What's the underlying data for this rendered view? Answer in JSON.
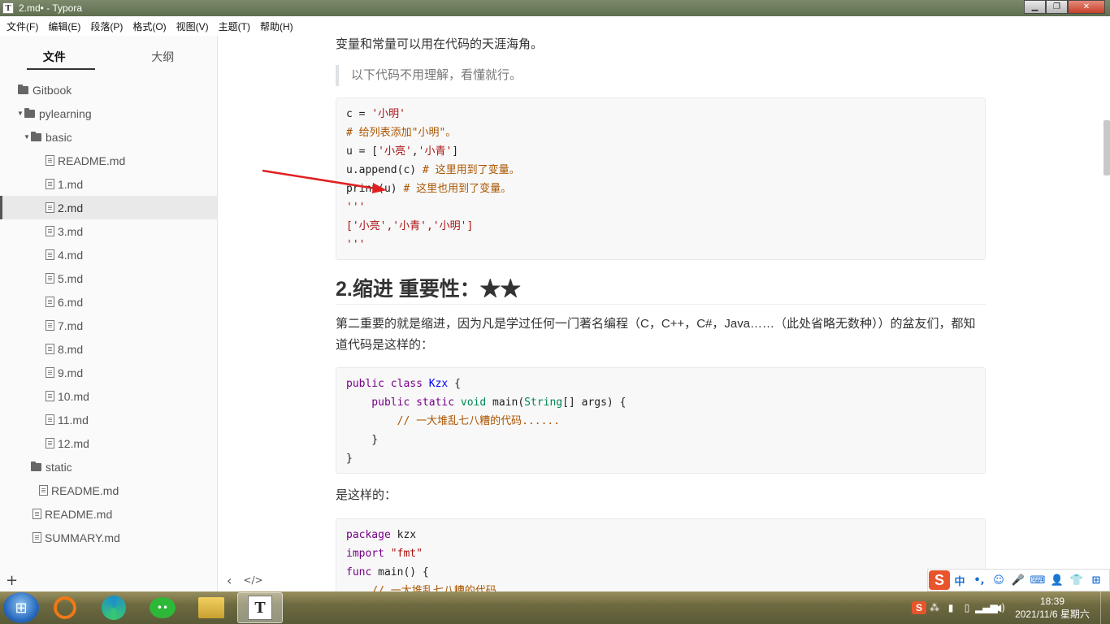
{
  "window": {
    "title": "2.md• - Typora"
  },
  "menu": [
    "文件(F)",
    "编辑(E)",
    "段落(P)",
    "格式(O)",
    "视图(V)",
    "主题(T)",
    "帮助(H)"
  ],
  "sidebar": {
    "tabs": [
      "文件",
      "大纲"
    ],
    "tree": [
      {
        "label": "Gitbook",
        "type": "folder",
        "level": 0,
        "expanded": false
      },
      {
        "label": "pylearning",
        "type": "folder",
        "level": 1,
        "expanded": true
      },
      {
        "label": "basic",
        "type": "folder",
        "level": 2,
        "expanded": true
      },
      {
        "label": "README.md",
        "type": "file",
        "level": 3
      },
      {
        "label": "1.md",
        "type": "file",
        "level": 3
      },
      {
        "label": "2.md",
        "type": "file",
        "level": 3,
        "active": true
      },
      {
        "label": "3.md",
        "type": "file",
        "level": 3
      },
      {
        "label": "4.md",
        "type": "file",
        "level": 3
      },
      {
        "label": "5.md",
        "type": "file",
        "level": 3
      },
      {
        "label": "6.md",
        "type": "file",
        "level": 3
      },
      {
        "label": "7.md",
        "type": "file",
        "level": 3
      },
      {
        "label": "8.md",
        "type": "file",
        "level": 3
      },
      {
        "label": "9.md",
        "type": "file",
        "level": 3
      },
      {
        "label": "10.md",
        "type": "file",
        "level": 3
      },
      {
        "label": "11.md",
        "type": "file",
        "level": 3
      },
      {
        "label": "12.md",
        "type": "file",
        "level": 3
      },
      {
        "label": "static",
        "type": "folder",
        "level": 2,
        "expanded": false
      },
      {
        "label": "README.md",
        "type": "file",
        "level": 2
      },
      {
        "label": "README.md",
        "type": "file",
        "level": 1
      },
      {
        "label": "SUMMARY.md",
        "type": "file",
        "level": 1
      }
    ],
    "add_label": "+"
  },
  "editor": {
    "intro": "变量和常量可以用在代码的天涯海角。",
    "quote": "以下代码不用理解，看懂就行。",
    "code1": [
      [
        [
          "c = ",
          "c-plain"
        ],
        [
          "'小明'",
          "c-str"
        ]
      ],
      [
        [
          "# 给列表添加\"小明\"。",
          "c-cm"
        ]
      ],
      [
        [
          "u = [",
          "c-plain"
        ],
        [
          "'小亮'",
          "c-str"
        ],
        [
          ",",
          "c-plain"
        ],
        [
          "'小青'",
          "c-str"
        ],
        [
          "]",
          "c-plain"
        ]
      ],
      [
        [
          "u.append(c) ",
          "c-plain"
        ],
        [
          "# 这里用到了变量。",
          "c-cm"
        ]
      ],
      [
        [
          "print(u) ",
          "c-plain"
        ],
        [
          "# 这里也用到了变量。",
          "c-cm"
        ]
      ],
      [
        [
          "'''",
          "c-str"
        ]
      ],
      [
        [
          "['小亮','小青','小明']",
          "c-str"
        ]
      ],
      [
        [
          "'''",
          "c-str"
        ]
      ]
    ],
    "heading": "2.缩进 重要性：★★",
    "para2": "第二重要的就是缩进，因为凡是学过任何一门著名编程（C，C++，C#，Java……（此处省略无数种））的盆友们，都知道代码是这样的：",
    "code2": [
      [
        [
          "public ",
          "c-kw"
        ],
        [
          "class ",
          "c-kw"
        ],
        [
          "Kzx",
          "c-def"
        ],
        [
          " {",
          "c-plain"
        ]
      ],
      [
        [
          "    public ",
          "c-kw"
        ],
        [
          "static ",
          "c-kw"
        ],
        [
          "void ",
          "c-type"
        ],
        [
          "main(",
          "c-plain"
        ],
        [
          "String",
          "c-type"
        ],
        [
          "[] args) {",
          "c-plain"
        ]
      ],
      [
        [
          "        // 一大堆乱七八糟的代码......",
          "c-cm"
        ]
      ],
      [
        [
          "    }",
          "c-plain"
        ]
      ],
      [
        [
          "}",
          "c-plain"
        ]
      ]
    ],
    "para3": "是这样的：",
    "code3": [
      [
        [
          "package ",
          "c-kw"
        ],
        [
          "kzx",
          "c-plain"
        ]
      ],
      [
        [
          "import ",
          "c-kw"
        ],
        [
          "\"fmt\"",
          "c-str"
        ]
      ],
      [
        [
          "func ",
          "c-kw"
        ],
        [
          "main() {",
          "c-plain"
        ]
      ],
      [
        [
          "    // 一大堆乱七八糟的代码......",
          "c-cm"
        ]
      ]
    ],
    "footer_back": "‹",
    "footer_source": "</>"
  },
  "ime": {
    "logo": "S",
    "items": [
      "中",
      "•,",
      "☺",
      "🎤",
      "⌨",
      "👤",
      "👕",
      "⊞"
    ]
  },
  "taskbar": {
    "clock_time": "18:39",
    "clock_date": "2021/11/6 星期六"
  },
  "colors": {
    "arrow": "#e02020",
    "accent": "#333333"
  }
}
